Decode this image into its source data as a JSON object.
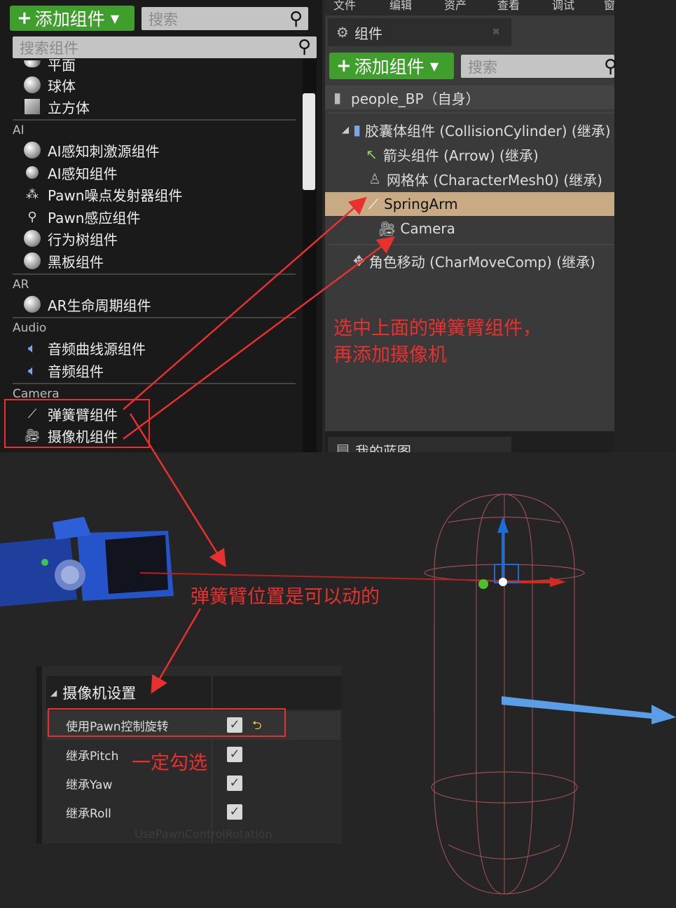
{
  "left_panel": {
    "add_button_label": "添加组件",
    "search_top_placeholder": "搜索",
    "search_placeholder": "搜索组件",
    "items": [
      {
        "label": "平面",
        "icon": "plane-icon"
      },
      {
        "label": "球体",
        "icon": "sphere-icon"
      },
      {
        "label": "立方体",
        "icon": "cube-icon"
      },
      {
        "label": "AI感知刺激源组件",
        "icon": "ai-stimuli-icon"
      },
      {
        "label": "AI感知组件",
        "icon": "ai-perception-icon"
      },
      {
        "label": "Pawn噪点发射器组件",
        "icon": "noise-emitter-icon"
      },
      {
        "label": "Pawn感应组件",
        "icon": "pawn-sensing-icon"
      },
      {
        "label": "行为树组件",
        "icon": "behavior-tree-icon"
      },
      {
        "label": "黑板组件",
        "icon": "blackboard-icon"
      },
      {
        "label": "AR生命周期组件",
        "icon": "ar-lifecycle-icon"
      },
      {
        "label": "音频曲线源组件",
        "icon": "audio-curve-icon"
      },
      {
        "label": "音频组件",
        "icon": "audio-icon"
      },
      {
        "label": "弹簧臂组件",
        "icon": "spring-arm-icon"
      },
      {
        "label": "摄像机组件",
        "icon": "camera-icon"
      }
    ],
    "categories": {
      "ai": "AI",
      "ar": "AR",
      "audio": "Audio",
      "camera": "Camera"
    }
  },
  "right_panel": {
    "menu_labels": [
      "文件",
      "编辑",
      "资产",
      "查看",
      "调试",
      "窗"
    ],
    "tab_title": "组件",
    "add_button_label": "添加组件",
    "search_placeholder": "搜索",
    "root": "people_BP（自身）",
    "tree": [
      {
        "label": "胶囊体组件 (CollisionCylinder) (继承)",
        "icon": "capsule-icon"
      },
      {
        "label": "箭头组件 (Arrow) (继承)",
        "icon": "arrow-icon"
      },
      {
        "label": "网格体 (CharacterMesh0) (继承)",
        "icon": "mesh-icon"
      },
      {
        "label": "SpringArm",
        "icon": "spring-arm-icon",
        "selected": true
      },
      {
        "label": "Camera",
        "icon": "camera-icon"
      },
      {
        "label": "角色移动 (CharMoveComp) (继承)",
        "icon": "character-movement-icon"
      }
    ],
    "bottom_tab": "我的蓝图"
  },
  "annotations": {
    "note1_line1": "选中上面的弹簧臂组件，",
    "note1_line2": "再添加摄像机",
    "note2": "弹簧臂位置是可以动的",
    "note3": "一定勾选"
  },
  "camera_settings": {
    "header": "摄像机设置",
    "rows": [
      {
        "label": "使用Pawn控制旋转",
        "checked": true
      },
      {
        "label": "继承Pitch",
        "checked": true
      },
      {
        "label": "继承Yaw",
        "checked": true
      },
      {
        "label": "继承Roll",
        "checked": true
      }
    ],
    "reset_icon": "reset-arrow-icon",
    "faded_tooltip": "UsePawnControlRotation"
  },
  "colors": {
    "accent_green": "#3f9e2c",
    "annotation_red": "#e8302e",
    "selection": "#c8ab84"
  }
}
